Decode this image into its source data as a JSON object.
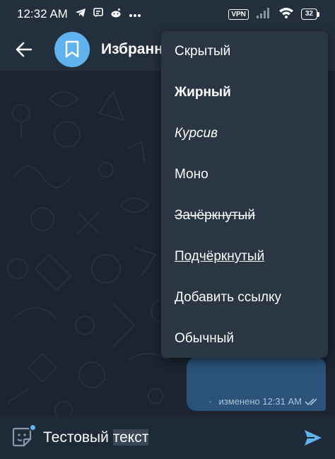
{
  "status_bar": {
    "time": "12:32 AM",
    "vpn": "VPN",
    "battery": "32",
    "icons": [
      "telegram-icon",
      "message-icon",
      "reddit-icon",
      "more-dots-icon",
      "signal-icon",
      "wifi-icon",
      "battery-icon"
    ]
  },
  "header": {
    "title": "Избранное",
    "back_icon": "arrow-left-icon",
    "avatar_icon": "bookmark-icon",
    "colors": {
      "bar": "#242f3d",
      "avatar": "#5fb2ee"
    }
  },
  "menu": {
    "items": [
      {
        "label": "Скрытый",
        "style": "plain"
      },
      {
        "label": "Жирный",
        "style": "bold"
      },
      {
        "label": "Курсив",
        "style": "italic"
      },
      {
        "label": "Моно",
        "style": "mono"
      },
      {
        "label": "Зачёркнутый",
        "style": "strikethrough"
      },
      {
        "label": "Подчёркнутый",
        "style": "underline"
      },
      {
        "label": "Добавить ссылку",
        "style": "plain"
      },
      {
        "label": "Обычный",
        "style": "plain"
      }
    ]
  },
  "message": {
    "status": "изменено 12:31 AM",
    "read_icon": "double-check-icon",
    "bubble_color": "#2b5278"
  },
  "composer": {
    "text_before": "Тестовый ",
    "text_selected": "текст",
    "sticker_icon": "sticker-icon",
    "send_icon": "send-icon",
    "accent": "#5fb2ee"
  }
}
